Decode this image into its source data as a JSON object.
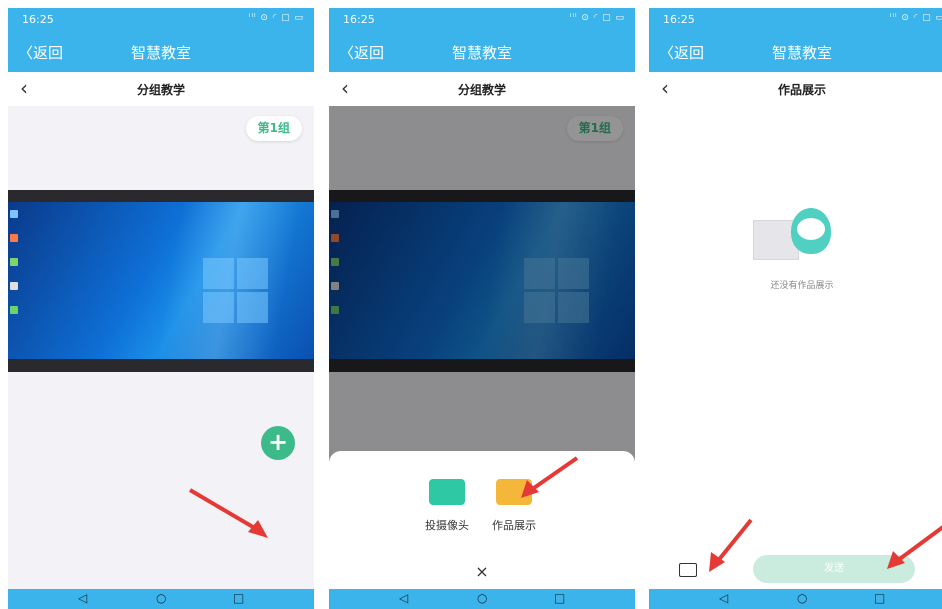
{
  "colors": {
    "brand": "#3ab4ea",
    "accent_green": "#3dba8a",
    "arrow_red": "#e53935"
  },
  "status": {
    "time": "16:25",
    "icons": "ⁱˡˡ ⊙ ◜ ▢ ▭"
  },
  "appbar": {
    "back_label": "〈返回",
    "title": "智慧教室"
  },
  "screen1": {
    "page_title": "分组教学",
    "group_tag": "第1组",
    "fab_icon": "plus-icon"
  },
  "screen2": {
    "page_title": "分组教学",
    "group_tag": "第1组",
    "sheet": {
      "options": [
        {
          "label": "投摄像头",
          "icon": "camera-icon"
        },
        {
          "label": "作品展示",
          "icon": "image-icon"
        }
      ],
      "close_label": "×"
    }
  },
  "screen3": {
    "page_title": "作品展示",
    "empty_text": "还没有作品展示",
    "send_label": "发送"
  },
  "navbar": {
    "back": "◁",
    "home": "○",
    "recents": "□"
  }
}
